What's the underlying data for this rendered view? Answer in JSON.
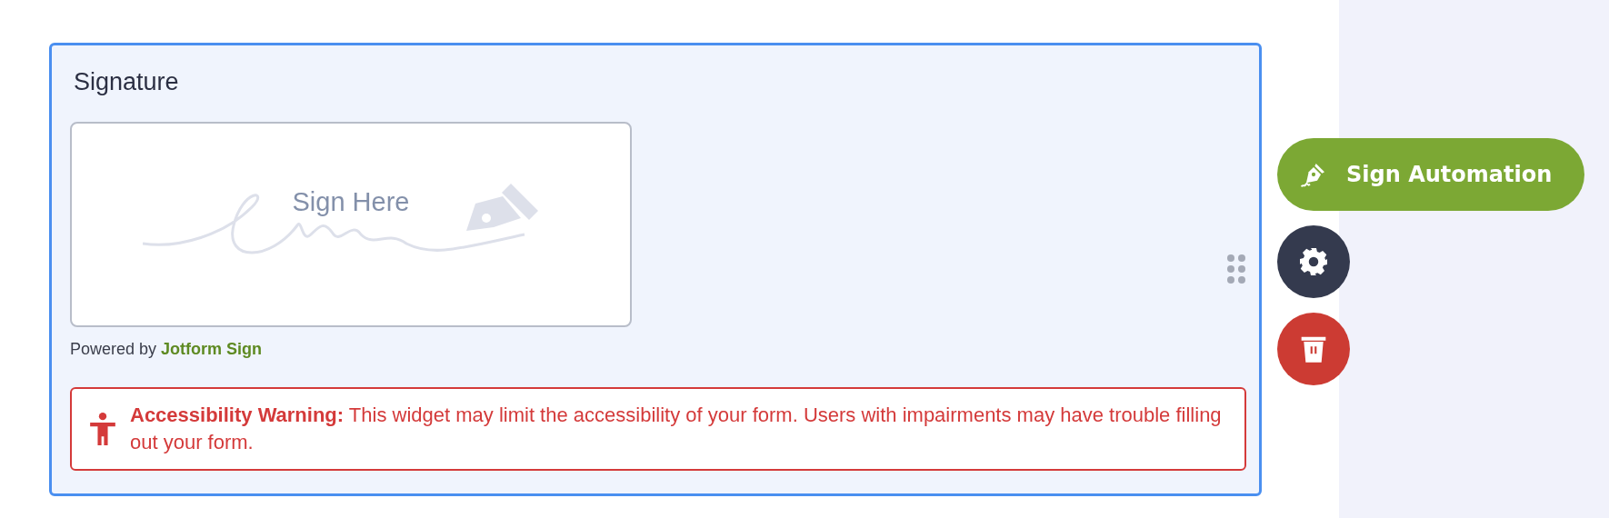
{
  "field": {
    "label": "Signature",
    "selected": true
  },
  "signature_pad": {
    "placeholder": "Sign Here"
  },
  "powered_by": {
    "text": "Powered by",
    "link": "Jotform Sign"
  },
  "warning": {
    "text": "**Accessibility Warning:** This widget may limit the accessibility of your form. Users with impairments may have trouble filling out your form."
  },
  "actions": [
    {
      "kind": "automation",
      "label": "Sign Automation"
    },
    {
      "kind": "settings"
    },
    {
      "kind": "delete"
    }
  ]
}
